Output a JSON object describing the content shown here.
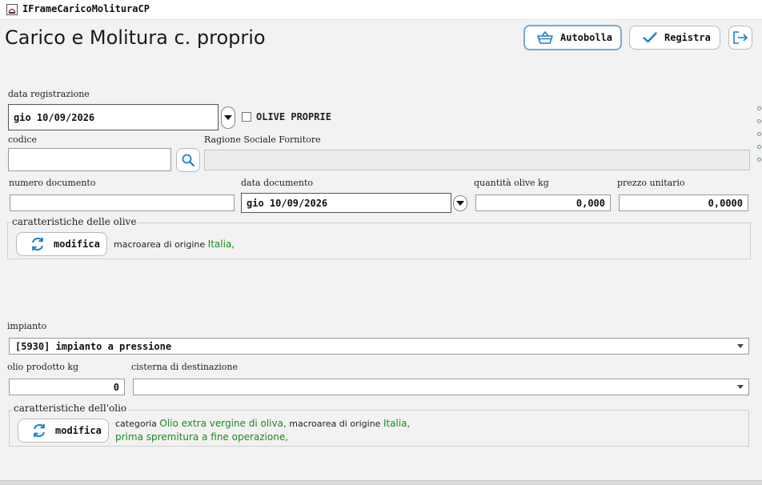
{
  "window": {
    "title": "IFrameCaricoMolituraCP"
  },
  "header": {
    "title": "Carico e Molitura c. proprio",
    "autobolla_label": "Autobolla",
    "registra_label": "Registra"
  },
  "registrazione": {
    "date_label": "data registrazione",
    "date_value": "gio 10/09/2026",
    "olive_proprie_label": "OLIVE PROPRIE",
    "olive_proprie_checked": false
  },
  "fornitore": {
    "codice_label": "codice",
    "codice_value": "",
    "ragione_sociale_label": "Ragione Sociale Fornitore",
    "ragione_sociale_value": ""
  },
  "documento": {
    "numero_label": "numero documento",
    "numero_value": "",
    "data_label": "data documento",
    "data_value": "gio 10/09/2026",
    "quantita_label": "quantità olive kg",
    "quantita_value": "0,000",
    "prezzo_label": "prezzo unitario",
    "prezzo_value": "0,0000"
  },
  "caratteristiche_olive": {
    "legend": "caratteristiche delle olive",
    "modifica_label": "modifica",
    "macroarea_label": "macroarea di origine",
    "macroarea_value": "Italia,"
  },
  "impianto": {
    "label": "impianto",
    "value": "[5930] impianto a pressione"
  },
  "produzione": {
    "olio_label": "olio prodotto kg",
    "olio_value": "0",
    "cisterna_label": "cisterna di destinazione",
    "cisterna_value": ""
  },
  "caratteristiche_olio": {
    "legend": "caratteristiche dell'olio",
    "modifica_label": "modifica",
    "categoria_label": "categoria",
    "categoria_value": "Olio extra vergine di oliva,",
    "macroarea_label": "macroarea di origine",
    "macroarea_value": "Italia,",
    "spremitura_value": "prima spremitura a fine operazione,"
  },
  "colors": {
    "accent_border": "#7aa7d8",
    "icon_blue": "#1e7fc9",
    "value_green": "#1d8a1d"
  }
}
